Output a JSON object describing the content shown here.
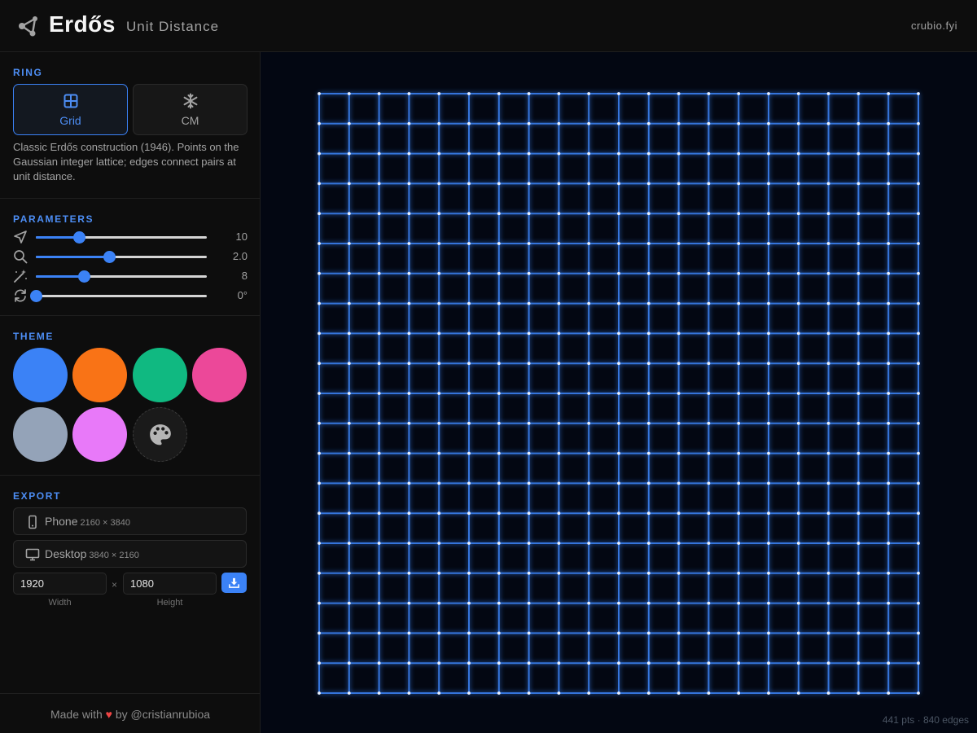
{
  "header": {
    "title": "Erdős",
    "subtitle": "Unit Distance",
    "site": "crubio.fyi",
    "logo_icon": "graph-nodes-icon"
  },
  "ring": {
    "title": "RING",
    "options": [
      {
        "label": "Grid",
        "icon": "grid-icon",
        "active": true
      },
      {
        "label": "CM",
        "icon": "snowflake-icon",
        "active": false
      }
    ],
    "description": "Classic Erdős construction (1946). Points on the Gaussian integer lattice; edges connect pairs at unit distance."
  },
  "parameters": {
    "title": "PARAMETERS",
    "items": [
      {
        "icon": "send-icon",
        "value": "10",
        "level": 0.25
      },
      {
        "icon": "zoom-icon",
        "value": "2.0",
        "level": 0.43
      },
      {
        "icon": "magic-wand-icon",
        "value": "8",
        "level": 0.28
      },
      {
        "icon": "rotate-icon",
        "value": "0°",
        "level": 0.0
      }
    ]
  },
  "theme": {
    "title": "THEME",
    "swatches": [
      "#3b82f6",
      "#f97316",
      "#10b981",
      "#ec4899",
      "#94a3b8",
      "#e879f9"
    ],
    "custom_icon": "palette-icon"
  },
  "export": {
    "title": "EXPORT",
    "presets": [
      {
        "name": "Phone",
        "dims": "2160 × 3840",
        "icon": "phone-icon"
      },
      {
        "name": "Desktop",
        "dims": "3840 × 2160",
        "icon": "monitor-icon"
      }
    ],
    "width_value": "1920",
    "height_value": "1080",
    "times": "×",
    "width_label": "Width",
    "height_label": "Height",
    "download_icon": "download-icon"
  },
  "footer": {
    "prefix": "Made with",
    "heart": "♥",
    "suffix": "by @cristianrubioa"
  },
  "canvas": {
    "stats": "441 pts · 840 edges",
    "accent": "#3b82f6",
    "lattice_size": 21
  }
}
